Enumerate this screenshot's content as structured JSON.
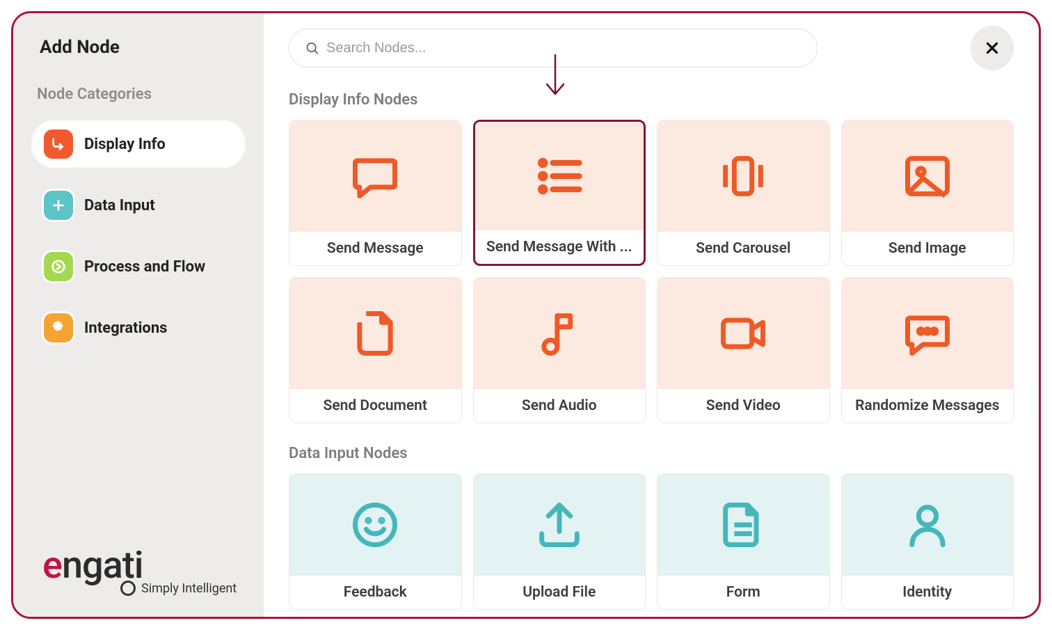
{
  "colors": {
    "accent_orange": "#ed5a27",
    "accent_teal": "#45b7bb",
    "highlight_border": "#82173a"
  },
  "sidebar": {
    "title": "Add Node",
    "categories_heading": "Node Categories",
    "items": [
      {
        "label": "Display Info",
        "icon": "corner-down-icon",
        "bg": "#f15a2e",
        "active": true
      },
      {
        "label": "Data Input",
        "icon": "plus-icon",
        "bg": "#5bc4c7",
        "active": false
      },
      {
        "label": "Process and Flow",
        "icon": "arrow-right-icon",
        "bg": "#a3d84f",
        "active": false
      },
      {
        "label": "Integrations",
        "icon": "puzzle-icon",
        "bg": "#f4a531",
        "active": false
      }
    ]
  },
  "search": {
    "placeholder": "Search Nodes..."
  },
  "sections": [
    {
      "title": "Display Info Nodes",
      "tint": "orange",
      "cards": [
        {
          "label": "Send Message",
          "icon": "message-icon"
        },
        {
          "label": "Send Message With ...",
          "icon": "list-icon",
          "highlight": true
        },
        {
          "label": "Send Carousel",
          "icon": "carousel-icon"
        },
        {
          "label": "Send Image",
          "icon": "image-icon"
        },
        {
          "label": "Send Document",
          "icon": "document-icon"
        },
        {
          "label": "Send Audio",
          "icon": "music-note-icon"
        },
        {
          "label": "Send Video",
          "icon": "video-icon"
        },
        {
          "label": "Randomize Messages",
          "icon": "ellipsis-message-icon"
        }
      ]
    },
    {
      "title": "Data Input Nodes",
      "tint": "teal",
      "cards": [
        {
          "label": "Feedback",
          "icon": "smile-icon"
        },
        {
          "label": "Upload File",
          "icon": "upload-icon"
        },
        {
          "label": "Form",
          "icon": "form-icon"
        },
        {
          "label": "Identity",
          "icon": "user-icon"
        }
      ]
    }
  ],
  "logo": {
    "brand": "engati",
    "tagline": "Simply Intelligent"
  }
}
